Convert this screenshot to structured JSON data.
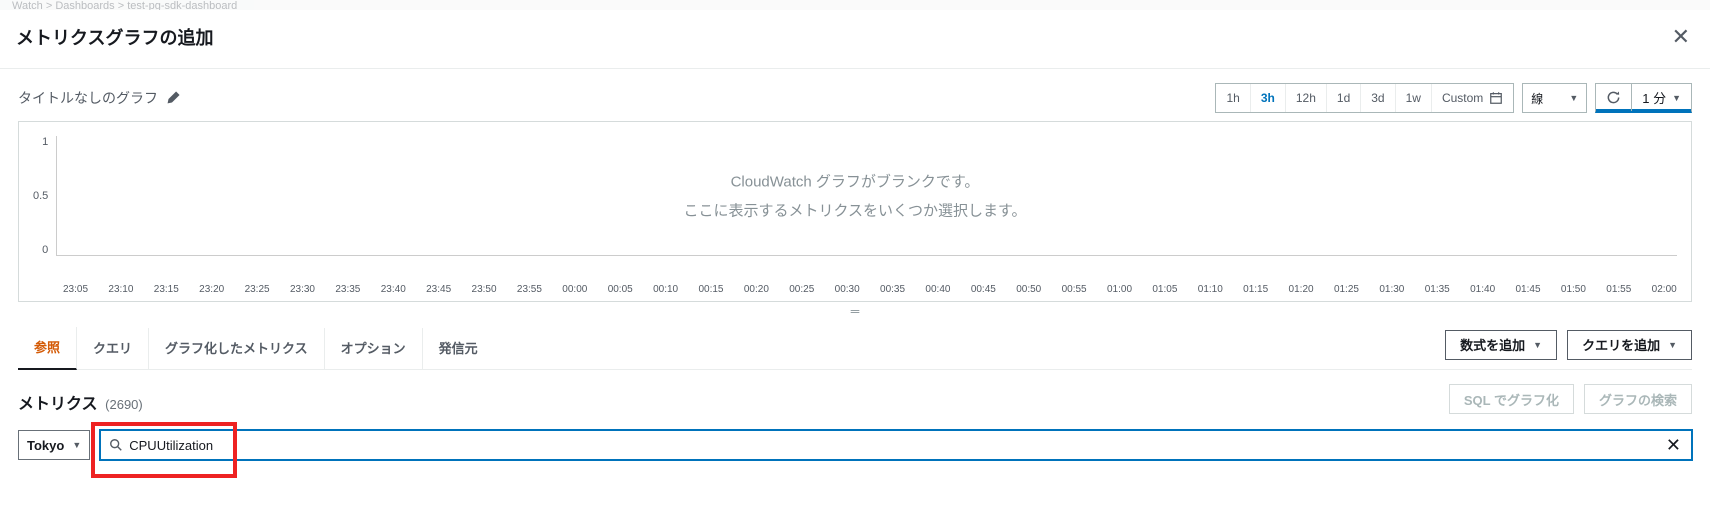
{
  "breadcrumb_parts": [
    "Watch",
    "Dashboards",
    "test-pg-sdk-dashboard"
  ],
  "dialog": {
    "title": "メトリクスグラフの追加"
  },
  "graph": {
    "title": "タイトルなしのグラフ",
    "empty_msg_line1": "CloudWatch グラフがブランクです。",
    "empty_msg_line2": "ここに表示するメトリクスをいくつか選択します。"
  },
  "time_ranges": [
    "1h",
    "3h",
    "12h",
    "1d",
    "3d",
    "1w"
  ],
  "time_ranges_active_index": 1,
  "custom_label": "Custom",
  "chart_type_select": "線",
  "refresh_interval": "1 分",
  "tabs": {
    "items": [
      "参照",
      "クエリ",
      "グラフ化したメトリクス",
      "オプション",
      "発信元"
    ],
    "active_index": 0
  },
  "buttons": {
    "add_expression": "数式を追加",
    "add_query": "クエリを追加",
    "sql_graph": "SQL でグラフ化",
    "search_graph": "グラフの検索"
  },
  "metrics_section": {
    "title": "メトリクス",
    "count": "(2690)",
    "region": "Tokyo",
    "search_value": "CPUUtilization"
  },
  "chart_data": {
    "type": "line",
    "title": "",
    "ylim": [
      0,
      1
    ],
    "y_ticks": [
      "1",
      "0.5",
      "0"
    ],
    "x_ticks": [
      "23:05",
      "23:10",
      "23:15",
      "23:20",
      "23:25",
      "23:30",
      "23:35",
      "23:40",
      "23:45",
      "23:50",
      "23:55",
      "00:00",
      "00:05",
      "00:10",
      "00:15",
      "00:20",
      "00:25",
      "00:30",
      "00:35",
      "00:40",
      "00:45",
      "00:50",
      "00:55",
      "01:00",
      "01:05",
      "01:10",
      "01:15",
      "01:20",
      "01:25",
      "01:30",
      "01:35",
      "01:40",
      "01:45",
      "01:50",
      "01:55",
      "02:00"
    ],
    "series": []
  }
}
